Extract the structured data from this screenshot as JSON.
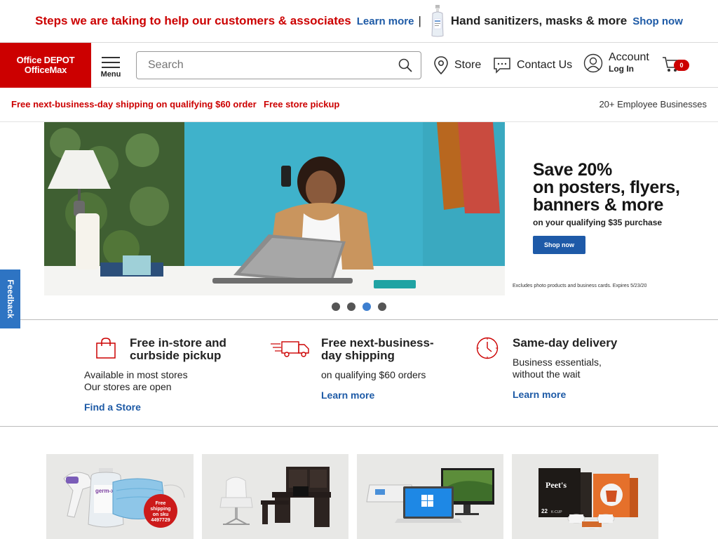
{
  "announcement": {
    "headline": "Steps we are taking to help our customers & associates",
    "learn_more": "Learn more",
    "separator": "|",
    "sanitizer_text": "Hand sanitizers, masks & more",
    "shop_now": "Shop now"
  },
  "header": {
    "logo_line1": "Office DEPOT",
    "logo_line2": "OfficeMax",
    "menu_label": "Menu",
    "search_placeholder": "Search",
    "store_label": "Store",
    "contact_label": "Contact Us",
    "account_label": "Account",
    "login_label": "Log In",
    "cart_count": "0"
  },
  "promo": {
    "shipping": "Free next-business-day shipping on qualifying $60 order",
    "pickup": "Free store pickup",
    "employee": "20+ Employee Businesses"
  },
  "hero": {
    "headline_1": "Save 20%",
    "headline_2": "on posters, flyers,",
    "headline_3": "banners & more",
    "subline": "on your qualifying $35 purchase",
    "button": "Shop now",
    "fine_print": "Excludes photo products and business cards.  Expires 5/23/20",
    "slides": 4,
    "active_slide": 3
  },
  "feedback": "Feedback",
  "features": [
    {
      "title_1": "Free in-store and",
      "title_2": "curbside pickup",
      "sub_1": "Available in most stores",
      "sub_2": "Our stores are open",
      "link": "Find a Store",
      "icon": "shopping-bag-icon"
    },
    {
      "title_1": "Free next-business-",
      "title_2": "day shipping",
      "sub_1": "on qualifying $60 orders",
      "link": "Learn more",
      "icon": "delivery-truck-icon"
    },
    {
      "title_1": "Same-day delivery",
      "sub_1": "Business essentials,",
      "sub_2": "without the wait",
      "link": "Learn more",
      "icon": "clock-icon"
    }
  ],
  "tiles": {
    "badge_1": "Free",
    "badge_2": "shipping",
    "badge_3": "on sku",
    "badge_4": "4497729",
    "germx": "germ-x",
    "peets": "Peet's",
    "coffee_count": "22",
    "coffee_k": "K-CUP"
  },
  "colors": {
    "brand_red": "#cc0000",
    "link_blue": "#1d5aa6",
    "feedback_blue": "#2e74c3",
    "dot_active": "#3d7fd0"
  }
}
